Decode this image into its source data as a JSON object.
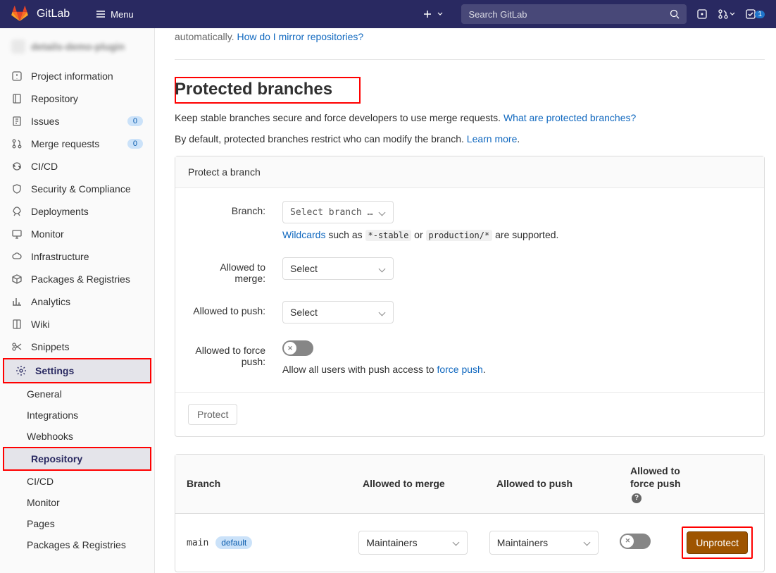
{
  "navbar": {
    "brand": "GitLab",
    "menu": "Menu",
    "search_placeholder": "Search GitLab",
    "todo_count": "1"
  },
  "sidebar": {
    "project_name": "details-demo-plugin",
    "items": [
      {
        "label": "Project information"
      },
      {
        "label": "Repository"
      },
      {
        "label": "Issues",
        "count": "0"
      },
      {
        "label": "Merge requests",
        "count": "0"
      },
      {
        "label": "CI/CD"
      },
      {
        "label": "Security & Compliance"
      },
      {
        "label": "Deployments"
      },
      {
        "label": "Monitor"
      },
      {
        "label": "Infrastructure"
      },
      {
        "label": "Packages & Registries"
      },
      {
        "label": "Analytics"
      },
      {
        "label": "Wiki"
      },
      {
        "label": "Snippets"
      },
      {
        "label": "Settings",
        "active": true
      }
    ],
    "settings_sub": [
      {
        "label": "General"
      },
      {
        "label": "Integrations"
      },
      {
        "label": "Webhooks"
      },
      {
        "label": "Repository",
        "active": true
      },
      {
        "label": "CI/CD"
      },
      {
        "label": "Monitor"
      },
      {
        "label": "Pages"
      },
      {
        "label": "Packages & Registries"
      }
    ]
  },
  "main": {
    "mirror_prefix": "automatically. ",
    "mirror_link": "How do I mirror repositories?",
    "title": "Protected branches",
    "desc1_text": "Keep stable branches secure and force developers to use merge requests. ",
    "desc1_link": "What are protected branches?",
    "desc2_text": "By default, protected branches restrict who can modify the branch. ",
    "desc2_link": "Learn more",
    "panel_title": "Protect a branch",
    "labels": {
      "branch": "Branch:",
      "merge": "Allowed to merge:",
      "push": "Allowed to push:",
      "force": "Allowed to force push:"
    },
    "branch_placeholder": "Select branch …",
    "select_placeholder": "Select",
    "wildcard_link": "Wildcards",
    "wildcard_text1": " such as ",
    "wildcard_code1": "*-stable",
    "wildcard_text2": " or ",
    "wildcard_code2": "production/*",
    "wildcard_text3": " are supported.",
    "force_help_text": "Allow all users with push access to ",
    "force_help_link": "force push",
    "protect_btn": "Protect",
    "table": {
      "headers": {
        "branch": "Branch",
        "merge": "Allowed to merge",
        "push": "Allowed to push",
        "force": "Allowed to force push"
      },
      "row": {
        "branch": "main",
        "badge": "default",
        "merge": "Maintainers",
        "push": "Maintainers",
        "unprotect": "Unprotect"
      }
    }
  }
}
